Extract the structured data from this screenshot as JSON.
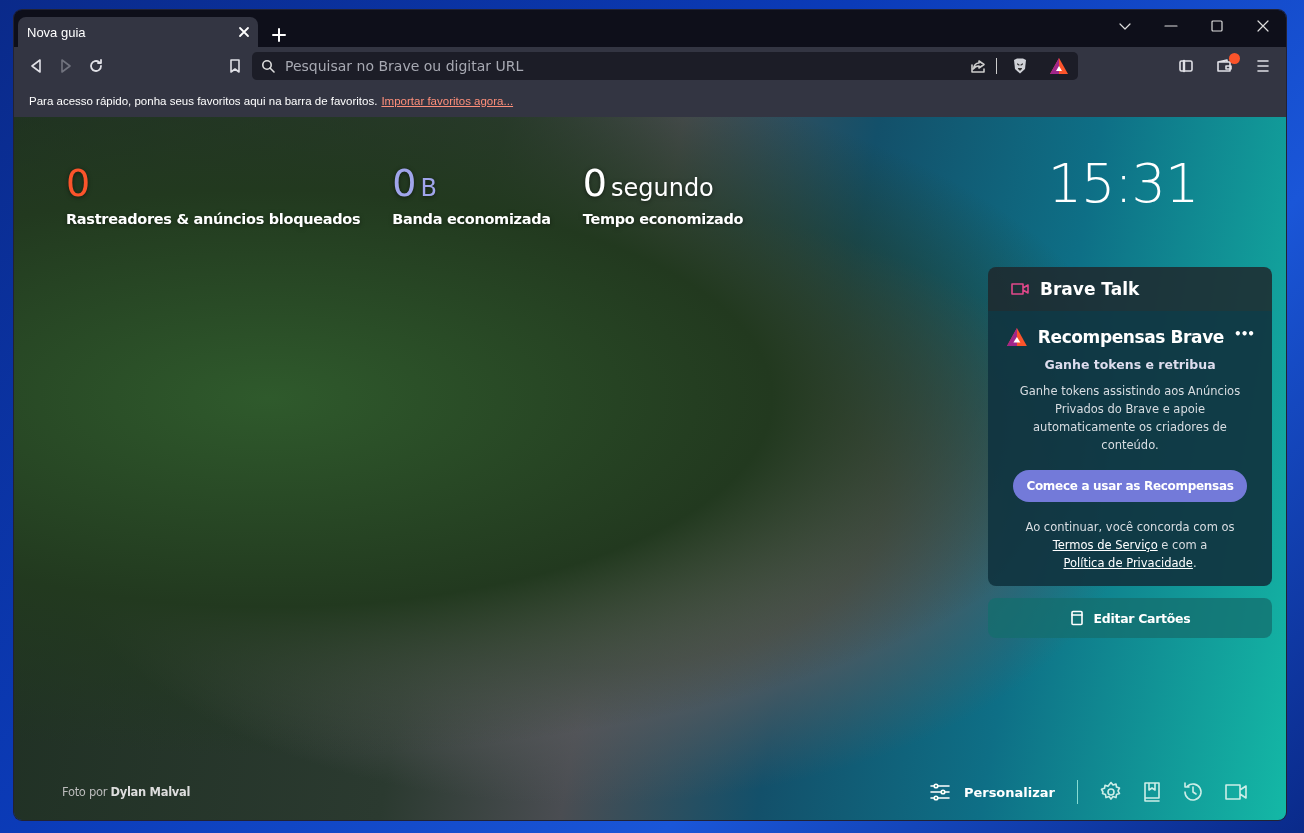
{
  "tabs": [
    {
      "label": "Nova guia",
      "selected": true
    }
  ],
  "address_bar": {
    "placeholder": "Pesquisar no Brave ou digitar URL"
  },
  "wallet_notification": true,
  "bookmarks_bar": {
    "message": "Para acesso rápido, ponha seus favoritos aqui na barra de favoritos.",
    "link": "Importar favoritos agora..."
  },
  "stats": [
    {
      "value": "0",
      "label": "Rastreadores & anúncios bloqueados",
      "color": "#fb542b"
    },
    {
      "value": "0",
      "unit": "B",
      "label": "Banda economizada",
      "color": "#a0a5eb"
    },
    {
      "value": "0",
      "unit": "segundo",
      "label": "Tempo economizado",
      "color": "#ffffff"
    }
  ],
  "clock": "15:31",
  "brave_talk": {
    "title": "Brave Talk"
  },
  "rewards": {
    "title": "Recompensas Brave",
    "more": "•••",
    "subtitle": "Ganhe tokens e retribua",
    "description": "Ganhe tokens assistindo aos Anúncios Privados do Brave e apoie automaticamente os criadores de conteúdo.",
    "button": "Comece a usar as Recompensas",
    "terms_prefix": "Ao continuar, você concorda com os",
    "terms_link": "Termos de Serviço",
    "terms_middle": "e com a",
    "privacy_link": "Política de Privacidade",
    "terms_suffix": "."
  },
  "edit_cards": "Editar Cartões",
  "photo_credit": "Foto por **Dylan Malval**",
  "customize": "Personalizar"
}
